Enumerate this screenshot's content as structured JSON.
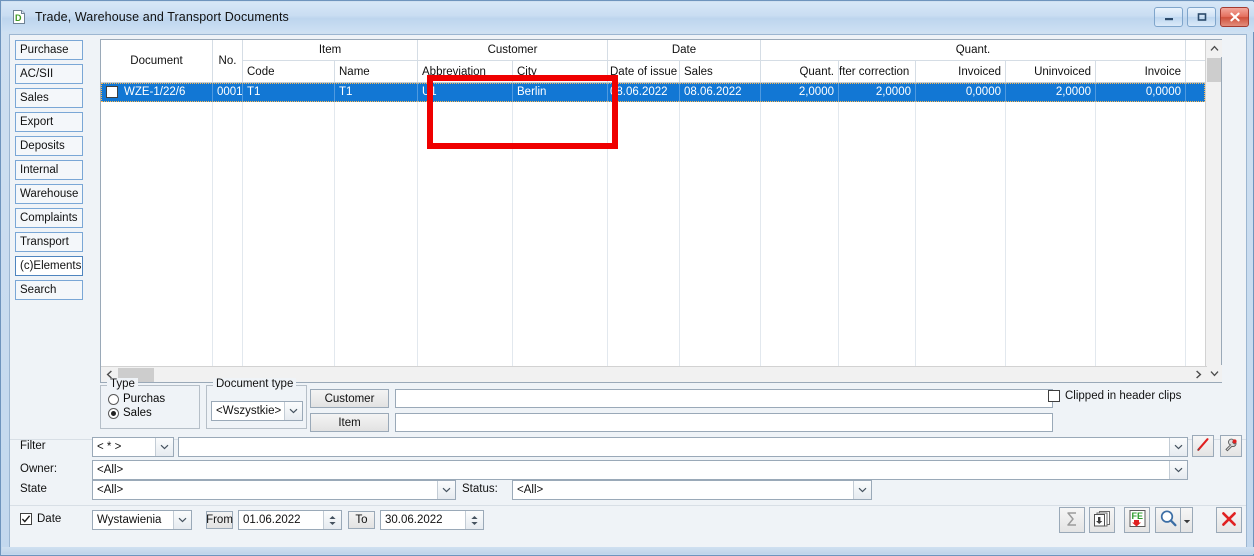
{
  "window": {
    "title": "Trade, Warehouse and Transport Documents",
    "app_icon": "document-icon",
    "minimize_label": "—",
    "maximize_label": "▢",
    "close_label": "✕"
  },
  "sidebar": {
    "items": [
      {
        "label": "Purchase",
        "active": false
      },
      {
        "label": "AC/SII",
        "active": false
      },
      {
        "label": "Sales",
        "active": false
      },
      {
        "label": "Export",
        "active": false
      },
      {
        "label": "Deposits",
        "active": false
      },
      {
        "label": "Internal",
        "active": false
      },
      {
        "label": "Warehouse",
        "active": false
      },
      {
        "label": "Complaints",
        "active": false
      },
      {
        "label": "Transport",
        "active": false
      },
      {
        "label": "(c)Elements",
        "active": true
      },
      {
        "label": "Search",
        "active": false
      }
    ]
  },
  "grid": {
    "group_headers": [
      {
        "label": "Item"
      },
      {
        "label": "Customer"
      },
      {
        "label": "Date"
      },
      {
        "label": "Quant."
      }
    ],
    "columns": [
      {
        "label": "Document"
      },
      {
        "label": "No."
      },
      {
        "label": "Code"
      },
      {
        "label": "Name"
      },
      {
        "label": "Abbreviation"
      },
      {
        "label": "City"
      },
      {
        "label": "Date of issue"
      },
      {
        "label": "Sales"
      },
      {
        "label": "Quant."
      },
      {
        "label": "fter correction"
      },
      {
        "label": "Invoiced"
      },
      {
        "label": "Uninvoiced"
      },
      {
        "label": "Invoice"
      },
      {
        "label": ""
      }
    ],
    "rows": [
      {
        "checked": false,
        "selected": true,
        "document": "WZE-1/22/6",
        "no": "0001",
        "code": "T1",
        "name": "T1",
        "abbreviation": "U1",
        "city": "Berlin",
        "date_of_issue": "08.06.2022",
        "sales": "08.06.2022",
        "quant": "2,0000",
        "after_correction": "2,0000",
        "invoiced": "0,0000",
        "uninvoiced": "2,0000",
        "invoice": "0,0000",
        "extra": ""
      }
    ],
    "selection_color": "#1277d4",
    "annotation_color": "#ef0000"
  },
  "panel": {
    "type_group_label": "Type",
    "type_options": [
      {
        "label": "Purchas",
        "selected": false
      },
      {
        "label": "Sales",
        "selected": true
      }
    ],
    "document_type_label": "Document type",
    "document_type_value": "<Wszystkie>",
    "customer_button": "Customer",
    "customer_value": "",
    "item_button": "Item",
    "item_value": "",
    "clipped_checkbox_label": "Clipped in header clips",
    "clipped_checked": false
  },
  "filters": {
    "filter_label": "Filter",
    "filter_select_value": "< * >",
    "filter_text_value": "",
    "owner_label": "Owner:",
    "owner_value": "<All>",
    "state_label": "State",
    "state_value": "<All>",
    "status_label": "Status:",
    "status_value": "<All>",
    "edit_filter_icon": "red-pen-icon",
    "filter_settings_icon": "wrench-icon"
  },
  "date_bar": {
    "date_checkbox_label": "Date",
    "date_checked": true,
    "date_kind_value": "Wystawienia",
    "from_label": "From",
    "from_value": "01.06.2022",
    "to_label": "To",
    "to_value": "30.06.2022"
  },
  "toolbar": {
    "buttons": [
      {
        "name": "sum-button",
        "icon": "sigma-icon",
        "enabled": false
      },
      {
        "name": "copy-button",
        "icon": "pages-icon",
        "enabled": true
      },
      {
        "name": "export-button",
        "icon": "fe-export-icon",
        "enabled": true
      },
      {
        "name": "search-button",
        "icon": "magnifier-icon",
        "enabled": true
      },
      {
        "name": "search-dropdown-button",
        "icon": "chevron-down-icon",
        "enabled": true
      },
      {
        "name": "close-button",
        "icon": "red-x-icon",
        "enabled": true
      }
    ]
  }
}
